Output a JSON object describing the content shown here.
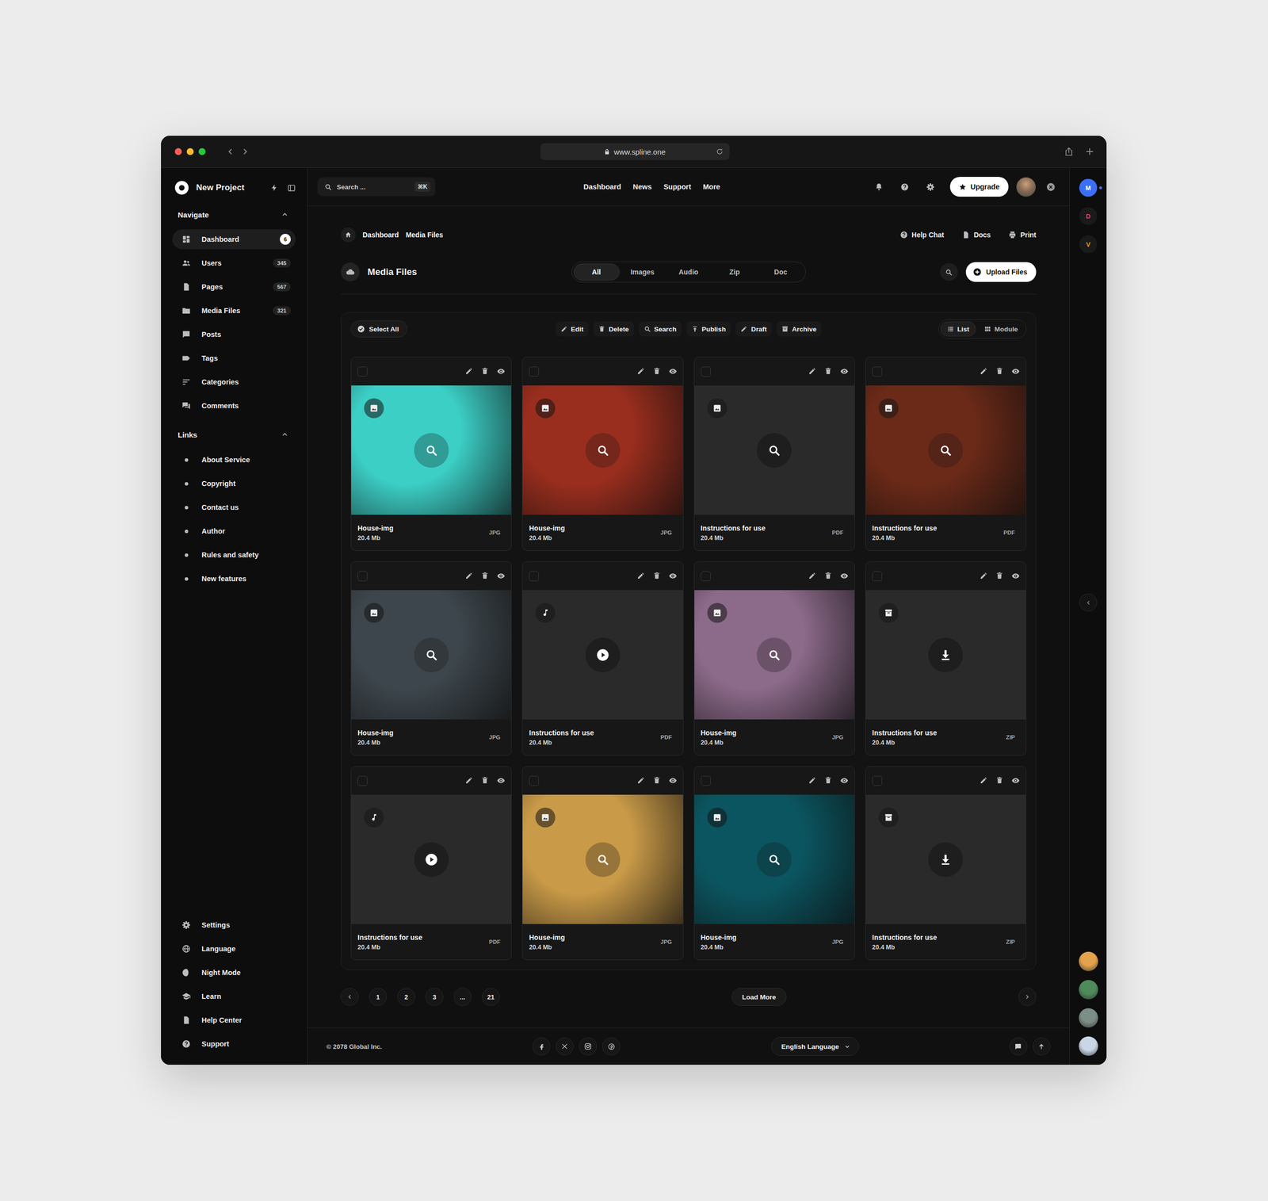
{
  "window": {
    "url": "www.spline.one"
  },
  "sidebar": {
    "project": "New Project",
    "navigate": {
      "title": "Navigate",
      "expanded": true,
      "items": [
        {
          "label": "Dashboard",
          "count": "6",
          "selected": true
        },
        {
          "label": "Users",
          "count": "345",
          "selected": false
        },
        {
          "label": "Pages",
          "count": "567",
          "selected": false
        },
        {
          "label": "Media Files",
          "count": "321",
          "selected": false
        },
        {
          "label": "Posts",
          "count": "",
          "selected": false
        },
        {
          "label": "Tags",
          "count": "",
          "selected": false
        },
        {
          "label": "Categories",
          "count": "",
          "selected": false
        },
        {
          "label": "Comments",
          "count": "",
          "selected": false
        }
      ]
    },
    "links": {
      "title": "Links",
      "expanded": true,
      "items": [
        "About Service",
        "Copyright",
        "Contact us",
        "Author",
        "Rules and safety",
        "New features"
      ]
    },
    "bottom": [
      "Settings",
      "Language",
      "Night Mode",
      "Learn",
      "Help Center",
      "Support"
    ]
  },
  "header": {
    "search": {
      "placeholder": "Search ...",
      "shortcut": "⌘K"
    },
    "nav": [
      "Dashboard",
      "News",
      "Support",
      "More"
    ],
    "upgrade": "Upgrade"
  },
  "breadcrumb": [
    "Dashboard",
    "Media Files"
  ],
  "page_actions": [
    "Help Chat",
    "Docs",
    "Print"
  ],
  "title": "Media Files",
  "filters": [
    {
      "label": "All",
      "selected": true
    },
    {
      "label": "Images",
      "selected": false
    },
    {
      "label": "Audio",
      "selected": false
    },
    {
      "label": "Zip",
      "selected": false
    },
    {
      "label": "Doc",
      "selected": false
    }
  ],
  "upload": "Upload Files",
  "toolbar": {
    "select_all": "Select All",
    "actions": [
      "Edit",
      "Delete",
      "Search",
      "Publish",
      "Draft",
      "Archive"
    ],
    "views": [
      {
        "label": "List",
        "selected": true
      },
      {
        "label": "Module",
        "selected": false
      }
    ]
  },
  "files": [
    {
      "title": "House-img",
      "size": "20.4 Mb",
      "type": "JPG",
      "kind": "photo",
      "color": "#3ccfc6",
      "checked": false
    },
    {
      "title": "House-img",
      "size": "20.4 Mb",
      "type": "JPG",
      "kind": "photo",
      "color": "#9a2e1e",
      "checked": false
    },
    {
      "title": "Instructions for use",
      "size": "20.4 Mb",
      "type": "PDF",
      "kind": "doc",
      "checked": false
    },
    {
      "title": "Instructions for use",
      "size": "20.4 Mb",
      "type": "PDF",
      "kind": "photo",
      "color": "#6b2a18",
      "checked": false
    },
    {
      "title": "House-img",
      "size": "20.4 Mb",
      "type": "JPG",
      "kind": "photo",
      "color": "#3d464c",
      "checked": false
    },
    {
      "title": "Instructions for use",
      "size": "20.4 Mb",
      "type": "PDF",
      "kind": "audio",
      "checked": false
    },
    {
      "title": "House-img",
      "size": "20.4 Mb",
      "type": "JPG",
      "kind": "photo",
      "color": "#8c6a8a",
      "checked": false
    },
    {
      "title": "Instructions for use",
      "size": "20.4 Mb",
      "type": "ZIP",
      "kind": "archive",
      "checked": false
    },
    {
      "title": "Instructions for use",
      "size": "20.4 Mb",
      "type": "PDF",
      "kind": "audio",
      "checked": false
    },
    {
      "title": "House-img",
      "size": "20.4 Mb",
      "type": "JPG",
      "kind": "photo",
      "color": "#c99a48",
      "checked": false
    },
    {
      "title": "House-img",
      "size": "20.4 Mb",
      "type": "JPG",
      "kind": "photo",
      "color": "#0b5560",
      "checked": false
    },
    {
      "title": "Instructions for use",
      "size": "20.4 Mb",
      "type": "ZIP",
      "kind": "archive",
      "checked": false
    }
  ],
  "pagination": {
    "pages": [
      {
        "label": "1",
        "selected": false
      },
      {
        "label": "2",
        "selected": false
      },
      {
        "label": "3",
        "selected": false
      },
      {
        "label": "...",
        "selected": false
      },
      {
        "label": "21",
        "selected": false
      }
    ],
    "load_more": "Load More"
  },
  "footer": {
    "copyright": "© 2078 Global Inc.",
    "language": "English Language"
  },
  "rail": {
    "workspaces": [
      {
        "letter": "M",
        "color": "#3b6ff5",
        "selected": true
      },
      {
        "letter": "D",
        "color": "#e0455f",
        "selected": false
      },
      {
        "letter": "V",
        "color": "#d9a520",
        "selected": false
      }
    ],
    "people": [
      {
        "color": "#e3a24c"
      },
      {
        "color": "#4f8a5c"
      },
      {
        "color": "#7b8f86"
      },
      {
        "color": "#c9d6e6"
      }
    ]
  }
}
